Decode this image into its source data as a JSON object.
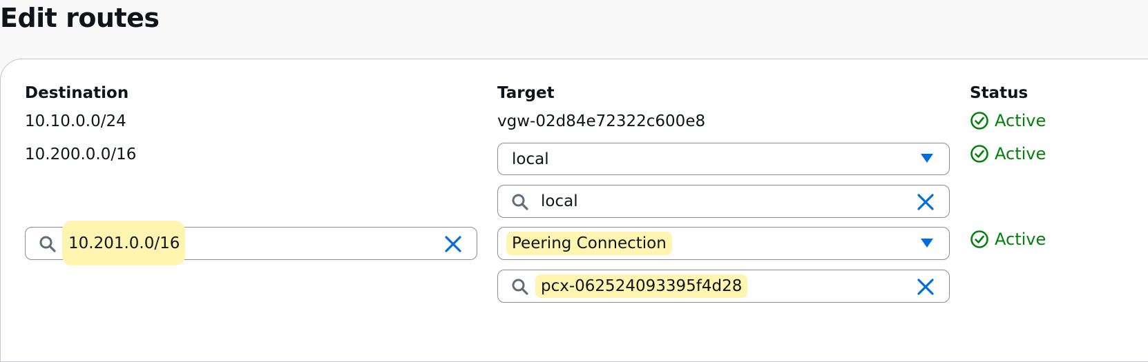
{
  "page": {
    "title": "Edit routes"
  },
  "columns": {
    "destination": "Destination",
    "target": "Target",
    "status": "Status"
  },
  "rows": [
    {
      "destination": "10.10.0.0/24",
      "target": "vgw-02d84e72322c600e8",
      "status": "Active"
    },
    {
      "destination": "10.200.0.0/16",
      "target_select": "local",
      "target_search": "local",
      "status": "Active"
    },
    {
      "destination_search": "10.201.0.0/16",
      "target_select": "Peering Connection",
      "target_search": "pcx-062524093395f4d28",
      "status": "Active"
    }
  ],
  "colors": {
    "status_active": "#037f0c",
    "accent_blue": "#006ce0",
    "highlight": "#fff4b0"
  },
  "icons": {
    "status": "check-circle-icon",
    "dropdown": "caret-down-icon",
    "search": "search-icon",
    "clear": "close-icon"
  }
}
